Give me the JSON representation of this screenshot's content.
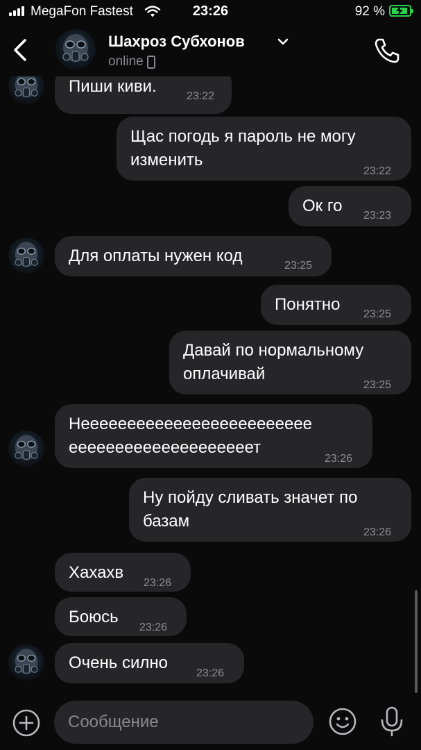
{
  "status_bar": {
    "carrier": "MegaFon Fastest",
    "time": "23:26",
    "battery_percent": "92 %",
    "battery_level": 0.92,
    "icons": [
      "signal-icon",
      "wifi-icon",
      "battery-charging-icon"
    ]
  },
  "header": {
    "contact_name": "Шахроз Субхонов",
    "status": "online",
    "icons": [
      "back-chevron-icon",
      "chevron-down-icon",
      "phone-device-icon",
      "phone-call-icon"
    ]
  },
  "messages": [
    {
      "direction": "incoming",
      "text": "Пиши киви.",
      "time": "23:22"
    },
    {
      "direction": "outgoing",
      "text": "Щас погодь я пароль не могу\nизменить",
      "time": "23:22"
    },
    {
      "direction": "outgoing",
      "text": "Ок го",
      "time": "23:23"
    },
    {
      "direction": "incoming",
      "text": "Для оплаты нужен код",
      "time": "23:25"
    },
    {
      "direction": "outgoing",
      "text": "Понятно",
      "time": "23:25"
    },
    {
      "direction": "outgoing",
      "text": "Давай по нормальному\nоплачивай",
      "time": "23:25"
    },
    {
      "direction": "incoming",
      "text": "Неееееееееееееееееееееееее\nеееееееееееееееееееет",
      "time": "23:26"
    },
    {
      "direction": "outgoing",
      "text": "Ну пойду сливать значет по\nбазам",
      "time": "23:26"
    },
    {
      "direction": "incoming",
      "text": "Хахахв",
      "time": "23:26"
    },
    {
      "direction": "incoming",
      "text": "Боюсь",
      "time": "23:26"
    },
    {
      "direction": "incoming",
      "text": "Очень силно",
      "time": "23:26"
    }
  ],
  "composer": {
    "placeholder": "Сообщение",
    "icons": [
      "plus-icon",
      "emoji-icon",
      "microphone-icon"
    ]
  },
  "colors": {
    "background": "#0a0a0a",
    "bubble": "#262628",
    "secondary_text": "#8a8a8e",
    "battery": "#2ad24f"
  }
}
